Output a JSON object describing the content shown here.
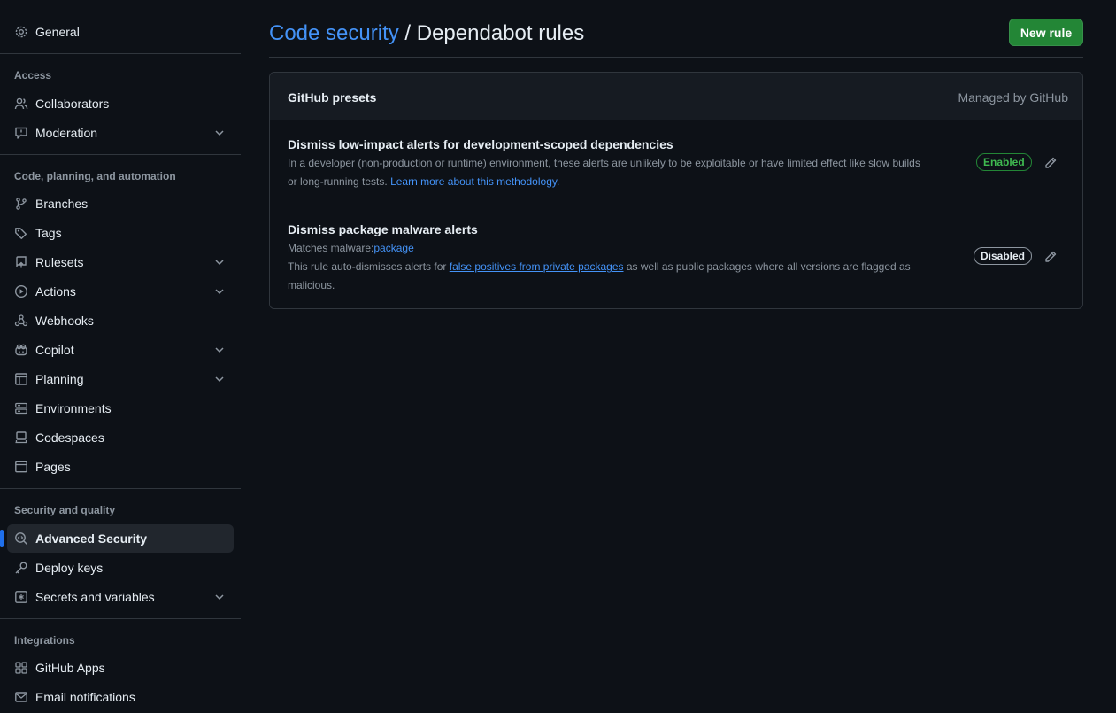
{
  "sidebar": {
    "general": "General",
    "sections": {
      "access": "Access",
      "code": "Code, planning, and automation",
      "security": "Security and quality",
      "integrations": "Integrations"
    },
    "items": {
      "collaborators": "Collaborators",
      "moderation": "Moderation",
      "branches": "Branches",
      "tags": "Tags",
      "rulesets": "Rulesets",
      "actions": "Actions",
      "webhooks": "Webhooks",
      "copilot": "Copilot",
      "planning": "Planning",
      "environments": "Environments",
      "codespaces": "Codespaces",
      "pages": "Pages",
      "advanced_security": "Advanced Security",
      "deploy_keys": "Deploy keys",
      "secrets": "Secrets and variables",
      "github_apps": "GitHub Apps",
      "email_notifications": "Email notifications"
    },
    "active_item": "Advanced Security",
    "accent_color": "#1f6feb"
  },
  "header": {
    "breadcrumb": "Code security",
    "separator": " / ",
    "title": "Dependabot rules",
    "new_rule_label": "New rule",
    "button_color": "#238636"
  },
  "presets": {
    "title": "GitHub presets",
    "managed_by": "Managed by GitHub",
    "rules": [
      {
        "title": "Dismiss low-impact alerts for development-scoped dependencies",
        "desc_line1": "In a developer (non-production or runtime) environment, these alerts are unlikely to be exploitable or have limited effect like slow builds",
        "desc_line2": "or long-running tests.",
        "link": "Learn more about this methodology.",
        "status": "Enabled",
        "status_color": "#3fb950"
      },
      {
        "title": "Dismiss package malware alerts",
        "match_prefix": "Matches malware:",
        "match_value": "package",
        "desc_prefix": "This rule auto-dismisses alerts for",
        "desc_link": "false positives from private packages",
        "desc_suffix_line1": "as well as public packages where all versions are flagged as",
        "desc_line2": "malicious.",
        "status": "Disabled"
      }
    ]
  }
}
